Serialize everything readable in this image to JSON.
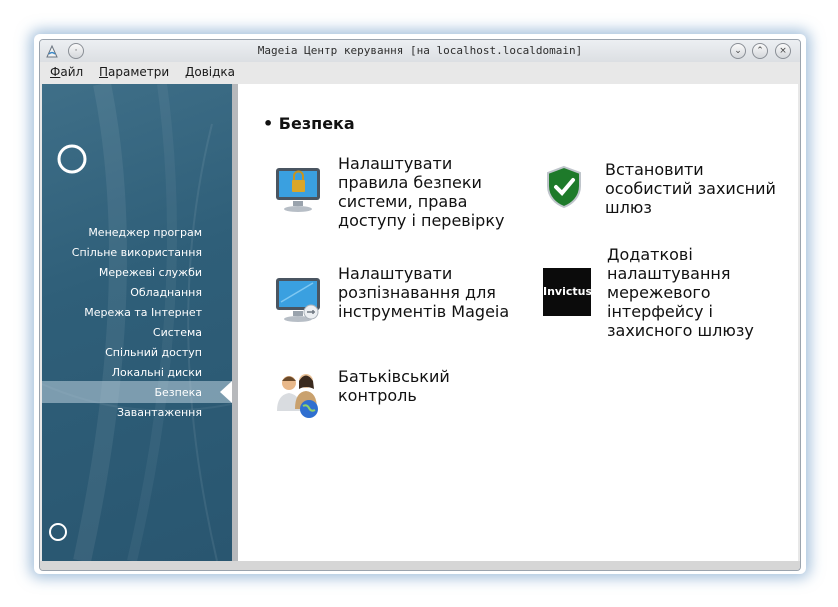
{
  "window": {
    "title": "Mageia Центр керування  [на localhost.localdomain]"
  },
  "menu": {
    "file": "Файл",
    "settings": "Параметри",
    "help": "Довідка"
  },
  "sidebar": {
    "items": [
      {
        "label": "Менеджер програм"
      },
      {
        "label": "Спільне використання"
      },
      {
        "label": "Мережеві служби"
      },
      {
        "label": "Обладнання"
      },
      {
        "label": "Мережа та Інтернет"
      },
      {
        "label": "Система"
      },
      {
        "label": "Спільний доступ"
      },
      {
        "label": "Локальні диски"
      },
      {
        "label": "Безпека"
      },
      {
        "label": "Завантаження"
      }
    ],
    "active_index": 8
  },
  "content": {
    "section_title": "Безпека",
    "tools": [
      {
        "label": "Налаштувати правила безпеки системи, права доступу і перевірку",
        "icon": "security-monitor-icon"
      },
      {
        "label": "Встановити особистий захисний шлюз",
        "icon": "shield-check-icon"
      },
      {
        "label": "Налаштувати розпізнавання для інструментів Mageia",
        "icon": "auth-monitor-icon"
      },
      {
        "label": "Додаткові налаштування мережевого інтерфейсу і захисного шлюзу",
        "icon": "invictus-logo"
      },
      {
        "label": "Батьківський контроль",
        "icon": "parental-control-icon"
      }
    ],
    "invictus_logo_text": "Invictus"
  },
  "colors": {
    "sidebar_bg": "#2f5f79",
    "active_item": "#a9c1cf"
  }
}
